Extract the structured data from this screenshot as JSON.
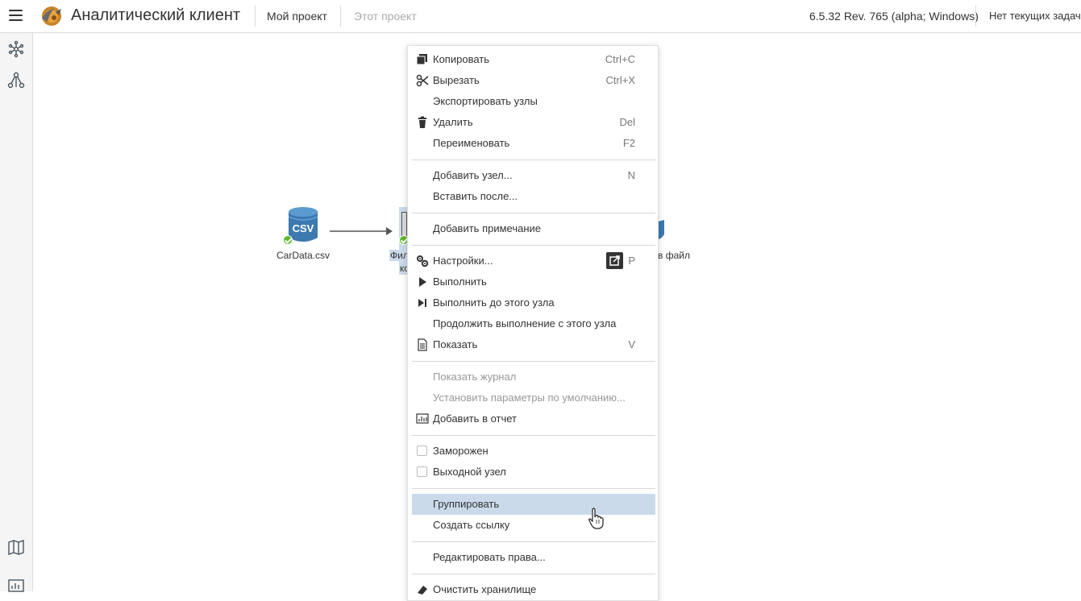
{
  "header": {
    "app_title": "Аналитический клиент",
    "nav": [
      {
        "label": "Мой проект",
        "state": "active"
      },
      {
        "label": "Этот проект",
        "state": "disabled"
      }
    ],
    "version": "6.5.32 Rev. 765 (alpha; Windows)",
    "tasks": "Нет текущих задач"
  },
  "sidebar": {
    "top_icons": [
      "snowflake-icon",
      "workflow-icon"
    ],
    "bottom_icons": [
      "map-icon",
      "report-icon"
    ]
  },
  "canvas": {
    "nodes": [
      {
        "label": "CarData.csv",
        "badge": "CSV",
        "status": "ok"
      },
      {
        "label_fragment": "Фил",
        "label_fragment2": "ко",
        "status": "ok"
      },
      {
        "label_fragment": "в файл"
      }
    ]
  },
  "menu": {
    "items": {
      "copy": {
        "label": "Копировать",
        "shortcut": "Ctrl+C"
      },
      "cut": {
        "label": "Вырезать",
        "shortcut": "Ctrl+X"
      },
      "export": {
        "label": "Экспортировать узлы"
      },
      "delete": {
        "label": "Удалить",
        "shortcut": "Del"
      },
      "rename": {
        "label": "Переименовать",
        "shortcut": "F2"
      },
      "add_node": {
        "label": "Добавить узел...",
        "shortcut": "N"
      },
      "insert_after": {
        "label": "Вставить после..."
      },
      "add_note": {
        "label": "Добавить примечание"
      },
      "settings": {
        "label": "Настройки...",
        "shortcut": "P"
      },
      "run": {
        "label": "Выполнить"
      },
      "run_to": {
        "label": "Выполнить до этого узла"
      },
      "continue_from": {
        "label": "Продолжить выполнение с этого узла"
      },
      "show": {
        "label": "Показать",
        "shortcut": "V"
      },
      "show_log": {
        "label": "Показать журнал"
      },
      "set_defaults": {
        "label": "Установить параметры по умолчанию..."
      },
      "add_report": {
        "label": "Добавить в отчет"
      },
      "frozen": {
        "label": "Заморожен",
        "checked": false
      },
      "output_node": {
        "label": "Выходной узел",
        "checked": false
      },
      "group": {
        "label": "Группировать"
      },
      "create_link": {
        "label": "Создать ссылку"
      },
      "edit_rights": {
        "label": "Редактировать права..."
      },
      "clear_storage": {
        "label": "Очистить хранилище"
      }
    }
  },
  "colors": {
    "highlight": "#cbdaea",
    "csv_blue": "#3d7ab0",
    "status_green": "#5cb82e"
  }
}
